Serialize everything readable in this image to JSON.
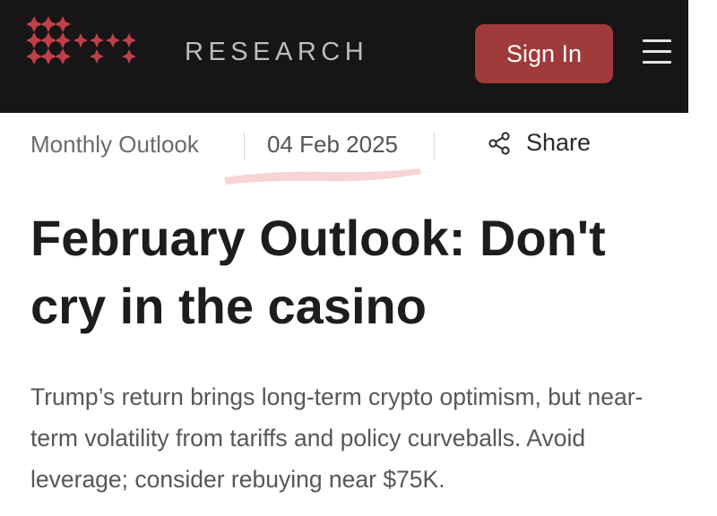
{
  "header": {
    "brand": "RESEARCH",
    "signin_label": "Sign In",
    "logo_icon": "diamond-star-grid-logo",
    "menu_icon": "hamburger-menu-icon",
    "colors": {
      "background": "#171515",
      "accent": "#a13a3b",
      "brand_text": "#bdbdbd"
    }
  },
  "meta": {
    "category": "Monthly Outlook",
    "date": "04 Feb 2025",
    "share_label": "Share",
    "share_icon": "share-nodes-icon",
    "highlight_color": "#f5c9c9"
  },
  "article": {
    "title": "February Outlook: Don't cry in the casino",
    "summary": "Trump’s return brings long-term crypto optimism, but near-term volatility from tariffs and policy curveballs. Avoid leverage; consider rebuying near $75K."
  }
}
